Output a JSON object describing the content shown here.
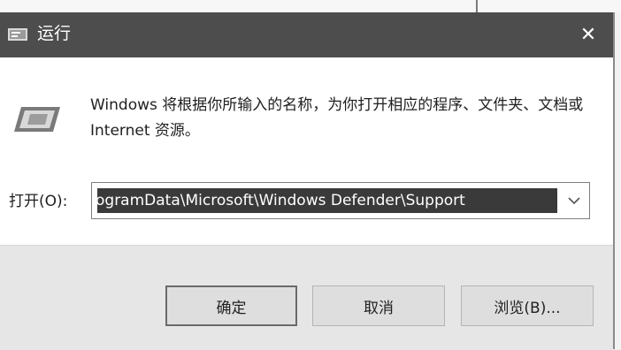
{
  "window": {
    "title": "运行",
    "close_glyph": "✕"
  },
  "content": {
    "description": "Windows 将根据你所输入的名称，为你打开相应的程序、文件夹、文档或 Internet 资源。",
    "open_label": "打开(O):",
    "open_value": "ogramData\\Microsoft\\Windows Defender\\Support"
  },
  "buttons": {
    "ok": "确定",
    "cancel": "取消",
    "browse": "浏览(B)..."
  },
  "icons": {
    "title": "run-app-icon",
    "main": "run-dialog-icon",
    "dropdown": "chevron-down-icon"
  }
}
